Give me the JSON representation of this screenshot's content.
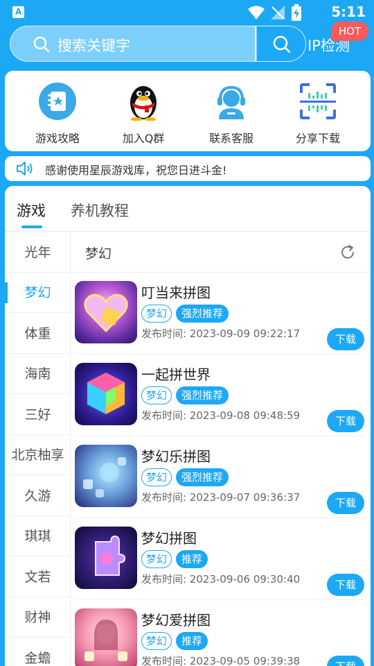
{
  "status_bar": {
    "app_badge": "A",
    "time": "5:11"
  },
  "search": {
    "placeholder": "搜索关键字"
  },
  "header": {
    "ip_check": "IP检测",
    "hot_badge": "HOT"
  },
  "quick_menu": [
    {
      "label": "游戏攻略",
      "icon": "guide-book-icon"
    },
    {
      "label": "加入Q群",
      "icon": "qq-penguin-icon"
    },
    {
      "label": "联系客服",
      "icon": "customer-service-icon"
    },
    {
      "label": "分享下载",
      "icon": "share-scan-icon"
    }
  ],
  "notice": {
    "text": "感谢使用星辰游戏库，祝您日进斗金!",
    "icon": "speaker-icon"
  },
  "tabs": [
    {
      "label": "游戏",
      "active": true
    },
    {
      "label": "养机教程",
      "active": false
    }
  ],
  "sidebar": {
    "items": [
      "光年",
      "梦幻",
      "体重",
      "海南",
      "三好",
      "北京柚享",
      "久游",
      "琪琪",
      "文若",
      "财神",
      "金蟾"
    ],
    "active_index": 1
  },
  "content": {
    "category_title": "梦幻",
    "games": [
      {
        "name": "叮当来拼图",
        "tags": [
          "梦幻",
          "强烈推荐"
        ],
        "date_label": "发布时间:",
        "date": "2023-09-09 09:22:17",
        "button": "下载"
      },
      {
        "name": "一起拼世界",
        "tags": [
          "梦幻",
          "强烈推荐"
        ],
        "date_label": "发布时间:",
        "date": "2023-09-08 09:48:59",
        "button": "下载"
      },
      {
        "name": "梦幻乐拼图",
        "tags": [
          "梦幻",
          "强烈推荐"
        ],
        "date_label": "发布时间:",
        "date": "2023-09-07 09:36:37",
        "button": "下载"
      },
      {
        "name": "梦幻拼图",
        "tags": [
          "梦幻",
          "推荐"
        ],
        "date_label": "发布时间:",
        "date": "2023-09-06 09:30:40",
        "button": "下载"
      },
      {
        "name": "梦幻爱拼图",
        "tags": [
          "梦幻",
          "推荐"
        ],
        "date_label": "发布时间:",
        "date": "2023-09-05 09:39:38",
        "button": "下载"
      }
    ]
  },
  "colors": {
    "primary": "#1da8f5",
    "hot": "#f85a5a",
    "text": "#222222"
  }
}
